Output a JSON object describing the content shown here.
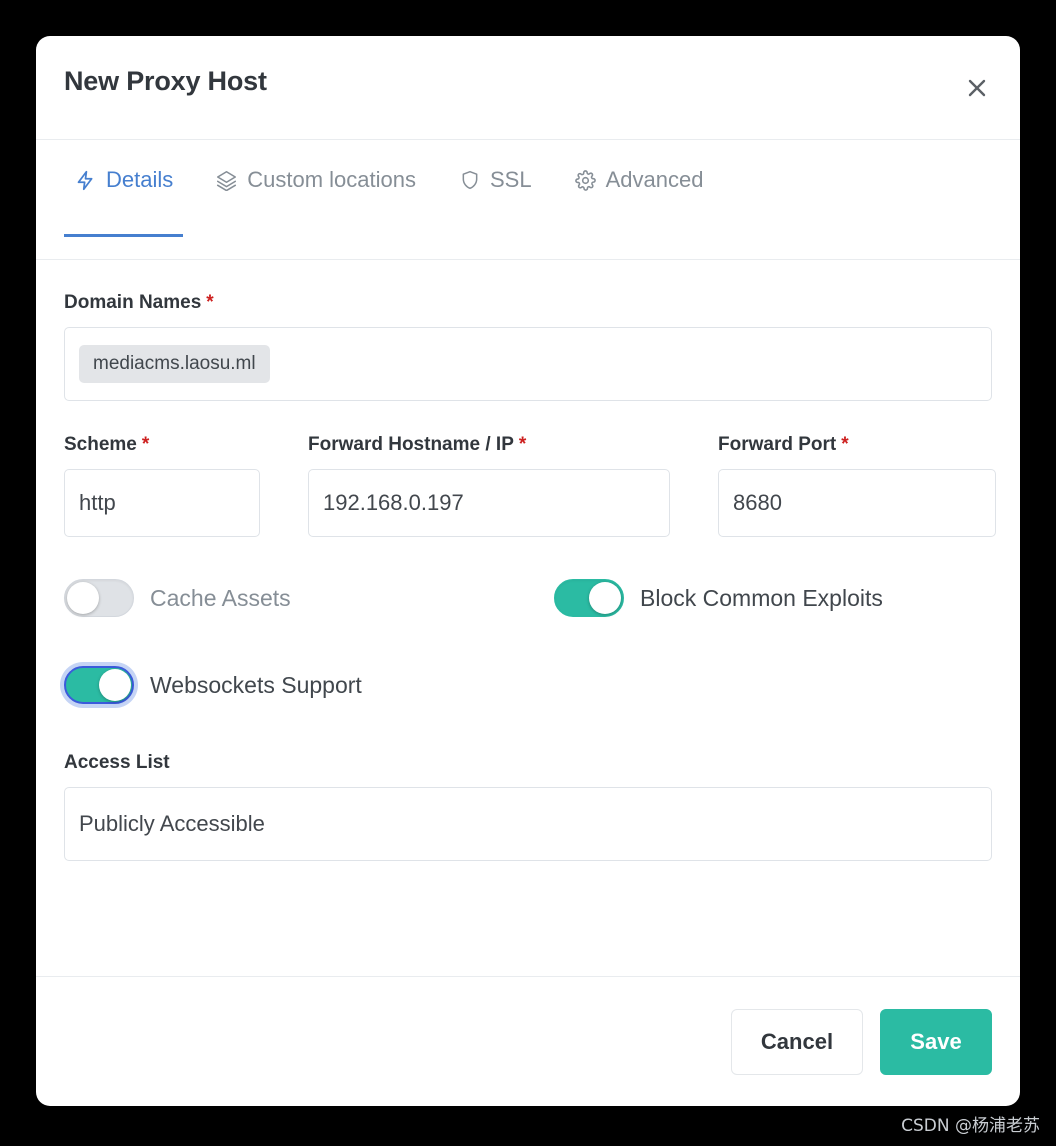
{
  "window": {
    "title": "New Proxy Host",
    "close_icon": "close-icon"
  },
  "tabs": [
    {
      "label": "Details",
      "icon": "lightning-bolt-icon",
      "active": true
    },
    {
      "label": "Custom locations",
      "icon": "layers-icon",
      "active": false
    },
    {
      "label": "SSL",
      "icon": "shield-icon",
      "active": false
    },
    {
      "label": "Advanced",
      "icon": "gear-icon",
      "active": false
    }
  ],
  "form": {
    "domain_names": {
      "label": "Domain Names",
      "required_marker": "*",
      "tags": [
        "mediacms.laosu.ml"
      ]
    },
    "scheme": {
      "label": "Scheme",
      "required_marker": "*",
      "value": "http"
    },
    "forward_hostname": {
      "label": "Forward Hostname / IP",
      "required_marker": "*",
      "value": "192.168.0.197"
    },
    "forward_port": {
      "label": "Forward Port",
      "required_marker": "*",
      "value": "8680"
    },
    "toggles": {
      "cache_assets": {
        "label": "Cache Assets",
        "state": "off"
      },
      "block_common_exploits": {
        "label": "Block Common Exploits",
        "state": "on"
      },
      "websockets_support": {
        "label": "Websockets Support",
        "state": "on"
      }
    },
    "access_list": {
      "label": "Access List",
      "value": "Publicly Accessible"
    }
  },
  "footer": {
    "cancel_label": "Cancel",
    "save_label": "Save"
  },
  "watermark": {
    "text": "CSDN @杨浦老苏"
  },
  "colors": {
    "accent_blue": "#467fcf",
    "accent_teal": "#2bbba3",
    "required_red": "#cd201f",
    "text_dark": "#32373d",
    "text_muted": "#868e96",
    "border": "#dfe3e8",
    "backdrop": "#000000"
  }
}
